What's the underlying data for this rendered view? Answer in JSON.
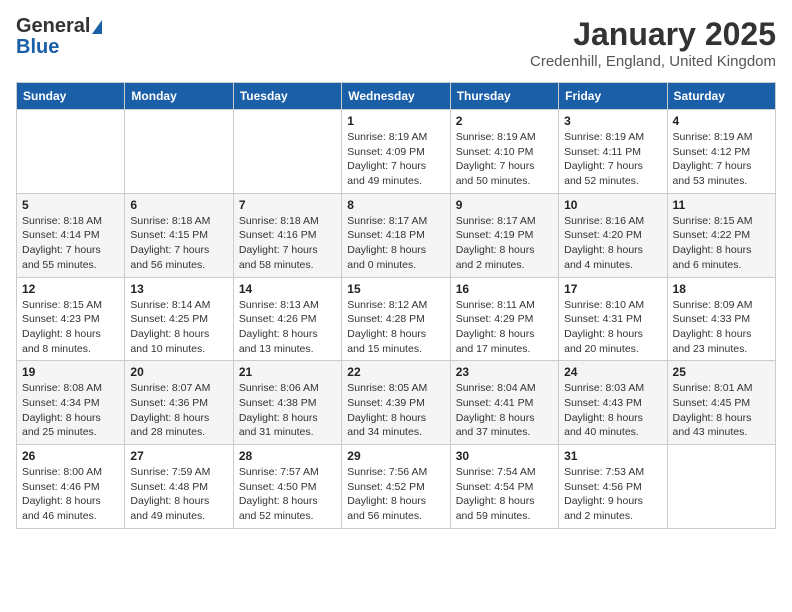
{
  "header": {
    "logo_general": "General",
    "logo_blue": "Blue",
    "title": "January 2025",
    "subtitle": "Credenhill, England, United Kingdom"
  },
  "days_of_week": [
    "Sunday",
    "Monday",
    "Tuesday",
    "Wednesday",
    "Thursday",
    "Friday",
    "Saturday"
  ],
  "weeks": [
    [
      {
        "day": "",
        "info": ""
      },
      {
        "day": "",
        "info": ""
      },
      {
        "day": "",
        "info": ""
      },
      {
        "day": "1",
        "info": "Sunrise: 8:19 AM\nSunset: 4:09 PM\nDaylight: 7 hours\nand 49 minutes."
      },
      {
        "day": "2",
        "info": "Sunrise: 8:19 AM\nSunset: 4:10 PM\nDaylight: 7 hours\nand 50 minutes."
      },
      {
        "day": "3",
        "info": "Sunrise: 8:19 AM\nSunset: 4:11 PM\nDaylight: 7 hours\nand 52 minutes."
      },
      {
        "day": "4",
        "info": "Sunrise: 8:19 AM\nSunset: 4:12 PM\nDaylight: 7 hours\nand 53 minutes."
      }
    ],
    [
      {
        "day": "5",
        "info": "Sunrise: 8:18 AM\nSunset: 4:14 PM\nDaylight: 7 hours\nand 55 minutes."
      },
      {
        "day": "6",
        "info": "Sunrise: 8:18 AM\nSunset: 4:15 PM\nDaylight: 7 hours\nand 56 minutes."
      },
      {
        "day": "7",
        "info": "Sunrise: 8:18 AM\nSunset: 4:16 PM\nDaylight: 7 hours\nand 58 minutes."
      },
      {
        "day": "8",
        "info": "Sunrise: 8:17 AM\nSunset: 4:18 PM\nDaylight: 8 hours\nand 0 minutes."
      },
      {
        "day": "9",
        "info": "Sunrise: 8:17 AM\nSunset: 4:19 PM\nDaylight: 8 hours\nand 2 minutes."
      },
      {
        "day": "10",
        "info": "Sunrise: 8:16 AM\nSunset: 4:20 PM\nDaylight: 8 hours\nand 4 minutes."
      },
      {
        "day": "11",
        "info": "Sunrise: 8:15 AM\nSunset: 4:22 PM\nDaylight: 8 hours\nand 6 minutes."
      }
    ],
    [
      {
        "day": "12",
        "info": "Sunrise: 8:15 AM\nSunset: 4:23 PM\nDaylight: 8 hours\nand 8 minutes."
      },
      {
        "day": "13",
        "info": "Sunrise: 8:14 AM\nSunset: 4:25 PM\nDaylight: 8 hours\nand 10 minutes."
      },
      {
        "day": "14",
        "info": "Sunrise: 8:13 AM\nSunset: 4:26 PM\nDaylight: 8 hours\nand 13 minutes."
      },
      {
        "day": "15",
        "info": "Sunrise: 8:12 AM\nSunset: 4:28 PM\nDaylight: 8 hours\nand 15 minutes."
      },
      {
        "day": "16",
        "info": "Sunrise: 8:11 AM\nSunset: 4:29 PM\nDaylight: 8 hours\nand 17 minutes."
      },
      {
        "day": "17",
        "info": "Sunrise: 8:10 AM\nSunset: 4:31 PM\nDaylight: 8 hours\nand 20 minutes."
      },
      {
        "day": "18",
        "info": "Sunrise: 8:09 AM\nSunset: 4:33 PM\nDaylight: 8 hours\nand 23 minutes."
      }
    ],
    [
      {
        "day": "19",
        "info": "Sunrise: 8:08 AM\nSunset: 4:34 PM\nDaylight: 8 hours\nand 25 minutes."
      },
      {
        "day": "20",
        "info": "Sunrise: 8:07 AM\nSunset: 4:36 PM\nDaylight: 8 hours\nand 28 minutes."
      },
      {
        "day": "21",
        "info": "Sunrise: 8:06 AM\nSunset: 4:38 PM\nDaylight: 8 hours\nand 31 minutes."
      },
      {
        "day": "22",
        "info": "Sunrise: 8:05 AM\nSunset: 4:39 PM\nDaylight: 8 hours\nand 34 minutes."
      },
      {
        "day": "23",
        "info": "Sunrise: 8:04 AM\nSunset: 4:41 PM\nDaylight: 8 hours\nand 37 minutes."
      },
      {
        "day": "24",
        "info": "Sunrise: 8:03 AM\nSunset: 4:43 PM\nDaylight: 8 hours\nand 40 minutes."
      },
      {
        "day": "25",
        "info": "Sunrise: 8:01 AM\nSunset: 4:45 PM\nDaylight: 8 hours\nand 43 minutes."
      }
    ],
    [
      {
        "day": "26",
        "info": "Sunrise: 8:00 AM\nSunset: 4:46 PM\nDaylight: 8 hours\nand 46 minutes."
      },
      {
        "day": "27",
        "info": "Sunrise: 7:59 AM\nSunset: 4:48 PM\nDaylight: 8 hours\nand 49 minutes."
      },
      {
        "day": "28",
        "info": "Sunrise: 7:57 AM\nSunset: 4:50 PM\nDaylight: 8 hours\nand 52 minutes."
      },
      {
        "day": "29",
        "info": "Sunrise: 7:56 AM\nSunset: 4:52 PM\nDaylight: 8 hours\nand 56 minutes."
      },
      {
        "day": "30",
        "info": "Sunrise: 7:54 AM\nSunset: 4:54 PM\nDaylight: 8 hours\nand 59 minutes."
      },
      {
        "day": "31",
        "info": "Sunrise: 7:53 AM\nSunset: 4:56 PM\nDaylight: 9 hours\nand 2 minutes."
      },
      {
        "day": "",
        "info": ""
      }
    ]
  ]
}
